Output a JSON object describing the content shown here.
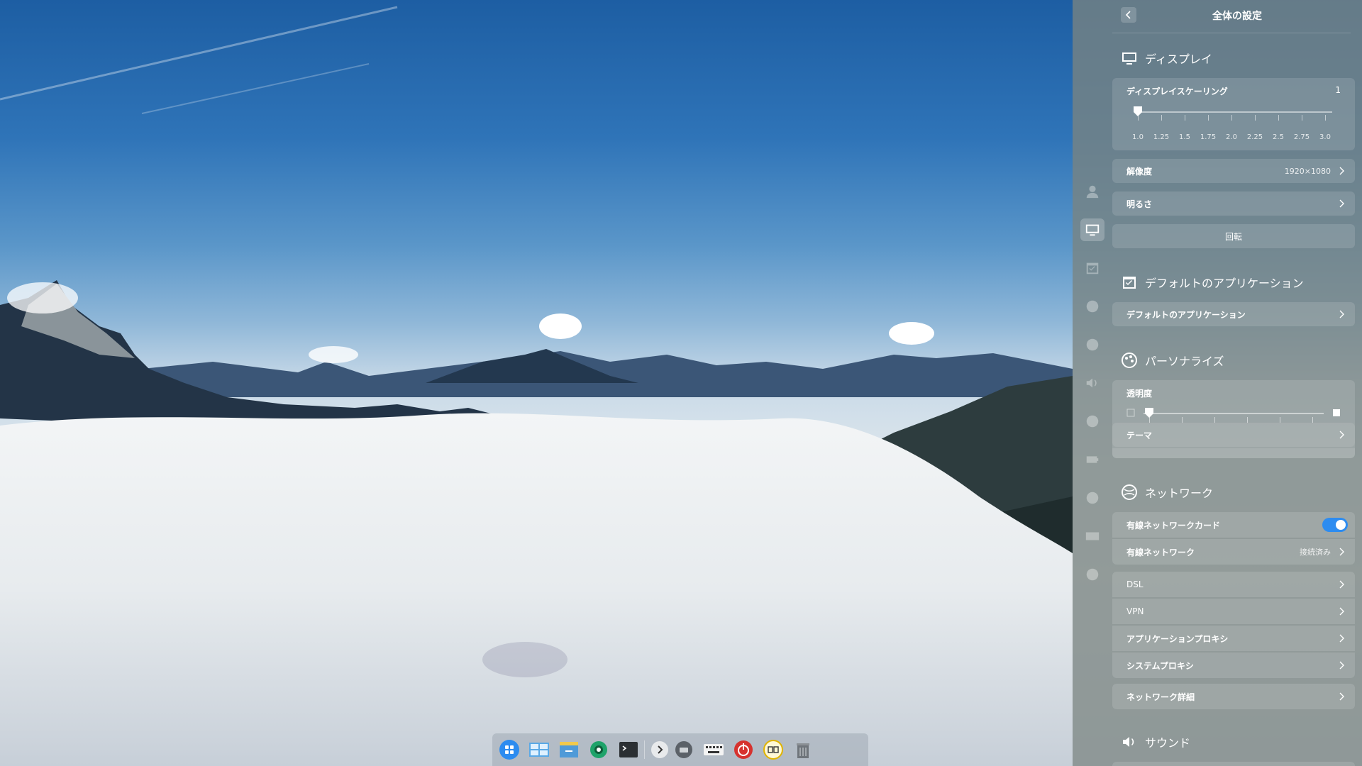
{
  "panel": {
    "title": "全体の設定",
    "display": {
      "heading": "ディスプレイ",
      "scaling": {
        "label": "ディスプレイスケーリング",
        "value": "1",
        "ticks": [
          "1.0",
          "1.25",
          "1.5",
          "1.75",
          "2.0",
          "2.25",
          "2.5",
          "2.75",
          "3.0"
        ]
      },
      "resolution": {
        "label": "解像度",
        "value": "1920×1080"
      },
      "brightness": {
        "label": "明るさ"
      },
      "rotate": {
        "label": "回転"
      }
    },
    "default_apps": {
      "heading": "デフォルトのアプリケーション",
      "row_label": "デフォルトのアプリケーション"
    },
    "personalize": {
      "heading": "パーソナライズ",
      "transparency_label": "透明度",
      "theme_label": "テーマ"
    },
    "network": {
      "heading": "ネットワーク",
      "wired_card": {
        "label": "有線ネットワークカード",
        "enabled": true
      },
      "wired_network": {
        "label": "有線ネットワーク",
        "status": "接続済み"
      },
      "dsl": "DSL",
      "vpn": "VPN",
      "app_proxy": "アプリケーションプロキシ",
      "system_proxy": "システムプロキシ",
      "details": "ネットワーク詳細"
    },
    "sound": {
      "heading": "サウンド"
    }
  },
  "sidebar_icons": [
    "accounts-icon",
    "display-icon",
    "default-apps-icon",
    "personalize-icon",
    "network-icon",
    "sound-icon",
    "time-icon",
    "power-icon",
    "mouse-icon",
    "keyboard-icon",
    "info-icon"
  ],
  "dock_icons": [
    "launcher-icon",
    "multitasking-icon",
    "file-manager-icon",
    "control-center-icon",
    "terminal-icon",
    "expand-arrow-icon",
    "notification-icon",
    "onboard-keyboard-icon",
    "shutdown-icon",
    "datetime-icon",
    "trash-icon"
  ],
  "colors": {
    "toggle_on": "#2d8cf0",
    "panel_bg": "rgba(122,132,130,0.78)"
  }
}
